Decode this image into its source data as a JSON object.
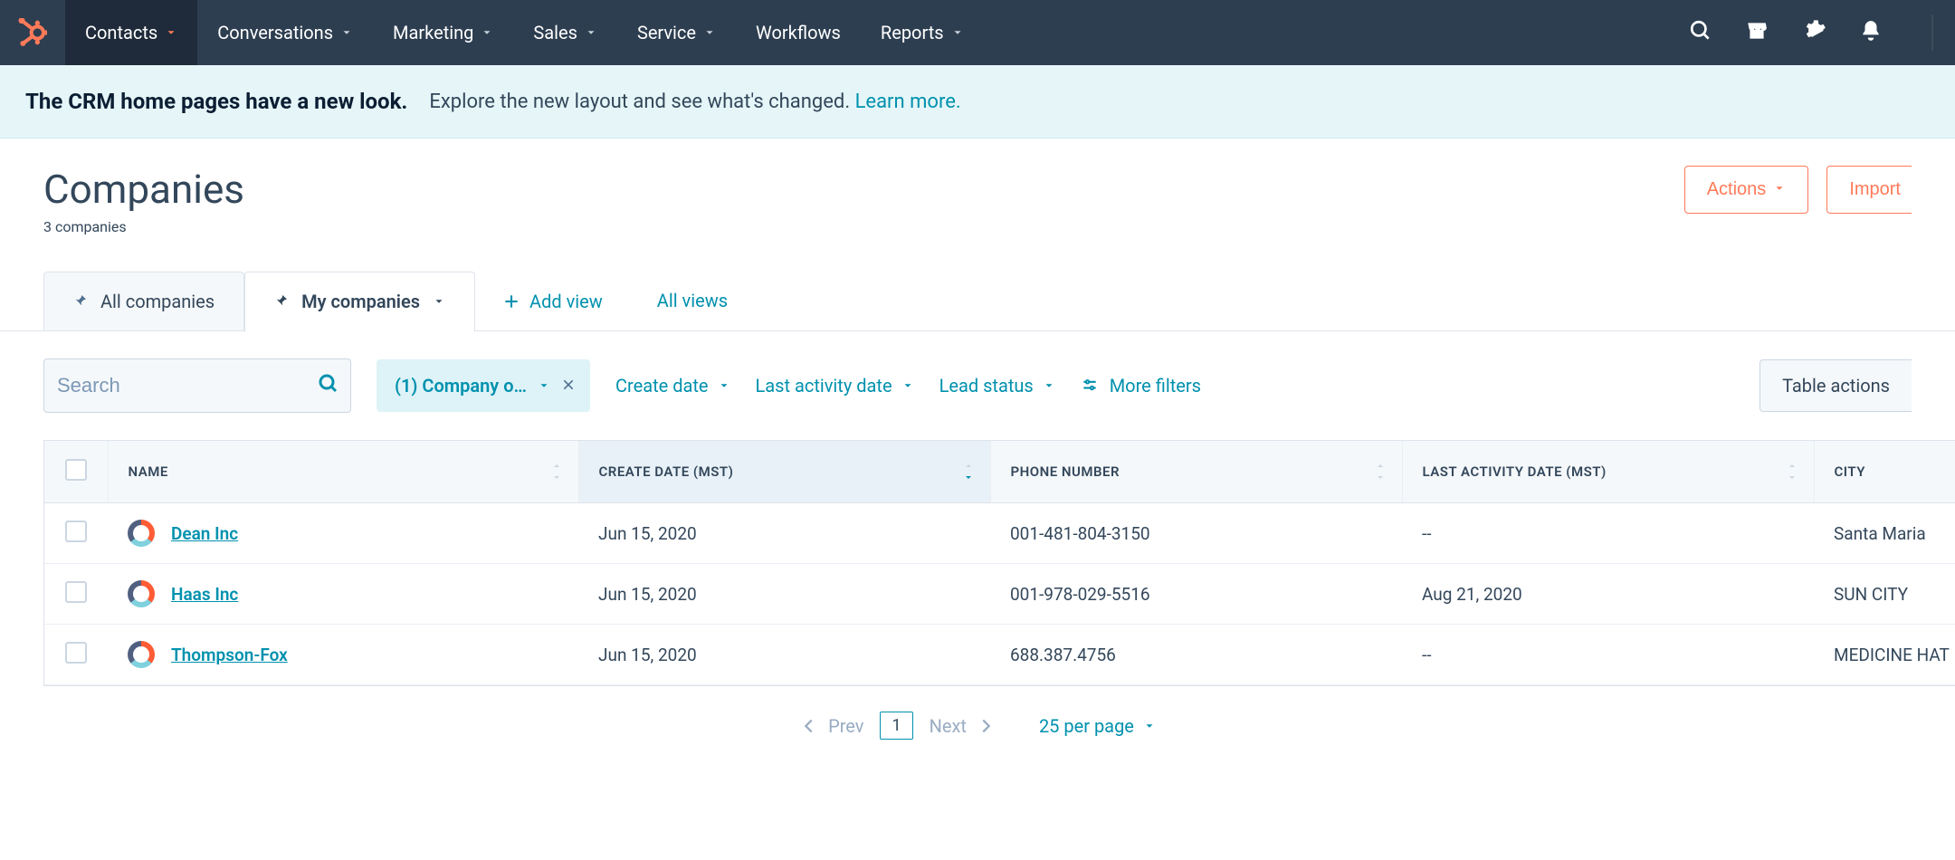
{
  "nav": {
    "items": [
      {
        "label": "Contacts",
        "active": true,
        "has_caret": true
      },
      {
        "label": "Conversations",
        "active": false,
        "has_caret": true
      },
      {
        "label": "Marketing",
        "active": false,
        "has_caret": true
      },
      {
        "label": "Sales",
        "active": false,
        "has_caret": true
      },
      {
        "label": "Service",
        "active": false,
        "has_caret": true
      },
      {
        "label": "Workflows",
        "active": false,
        "has_caret": false
      },
      {
        "label": "Reports",
        "active": false,
        "has_caret": true
      }
    ]
  },
  "banner": {
    "headline": "The CRM home pages have a new look.",
    "subtext": "Explore the new layout and see what's changed. ",
    "link": "Learn more."
  },
  "page": {
    "title": "Companies",
    "count": "3 companies",
    "actions_label": "Actions",
    "import_label": "Import"
  },
  "tabs": {
    "all_label": "All companies",
    "my_label": "My companies",
    "add_view": "Add view",
    "all_views": "All views"
  },
  "filters": {
    "search_placeholder": "Search",
    "chip_label": "(1) Company o…",
    "create_date": "Create date",
    "last_activity": "Last activity date",
    "lead_status": "Lead status",
    "more_filters": "More filters",
    "table_actions": "Table actions"
  },
  "table": {
    "columns": {
      "name": "NAME",
      "create": "CREATE DATE (MST)",
      "phone": "PHONE NUMBER",
      "last": "LAST ACTIVITY DATE (MST)",
      "city": "CITY"
    },
    "rows": [
      {
        "name": "Dean Inc",
        "create": "Jun 15, 2020",
        "phone": "001-481-804-3150",
        "last": "--",
        "city": "Santa Maria"
      },
      {
        "name": "Haas Inc",
        "create": "Jun 15, 2020",
        "phone": "001-978-029-5516",
        "last": "Aug 21, 2020",
        "city": "SUN CITY"
      },
      {
        "name": "Thompson-Fox",
        "create": "Jun 15, 2020",
        "phone": "688.387.4756",
        "last": "--",
        "city": "MEDICINE HAT"
      }
    ]
  },
  "pagination": {
    "prev": "Prev",
    "next": "Next",
    "page": "1",
    "per_page": "25 per page"
  }
}
